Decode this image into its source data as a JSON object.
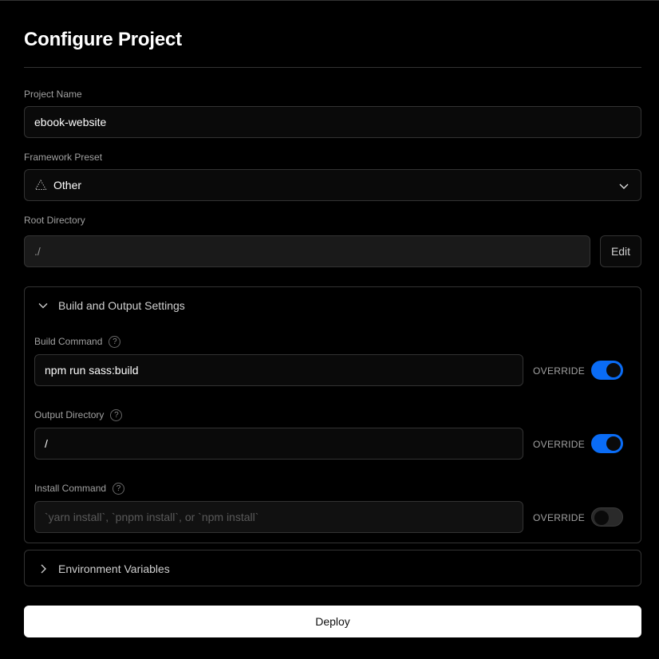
{
  "page": {
    "title": "Configure Project"
  },
  "project_name": {
    "label": "Project Name",
    "value": "ebook-website"
  },
  "framework": {
    "label": "Framework Preset",
    "value": "Other",
    "icon": "triangle-dotted-icon"
  },
  "root_directory": {
    "label": "Root Directory",
    "value": "./",
    "edit_label": "Edit"
  },
  "build_settings": {
    "title": "Build and Output Settings",
    "expanded": true,
    "override_label": "OVERRIDE",
    "build_command": {
      "label": "Build Command",
      "value": "npm run sass:build",
      "override": true
    },
    "output_directory": {
      "label": "Output Directory",
      "value": "/",
      "override": true
    },
    "install_command": {
      "label": "Install Command",
      "placeholder": "`yarn install`, `pnpm install`, or `npm install`",
      "override": false
    }
  },
  "env_vars": {
    "title": "Environment Variables",
    "expanded": false
  },
  "deploy": {
    "label": "Deploy"
  },
  "colors": {
    "toggle_on": "#0a6cf5",
    "background": "#000000",
    "border": "#333333"
  }
}
